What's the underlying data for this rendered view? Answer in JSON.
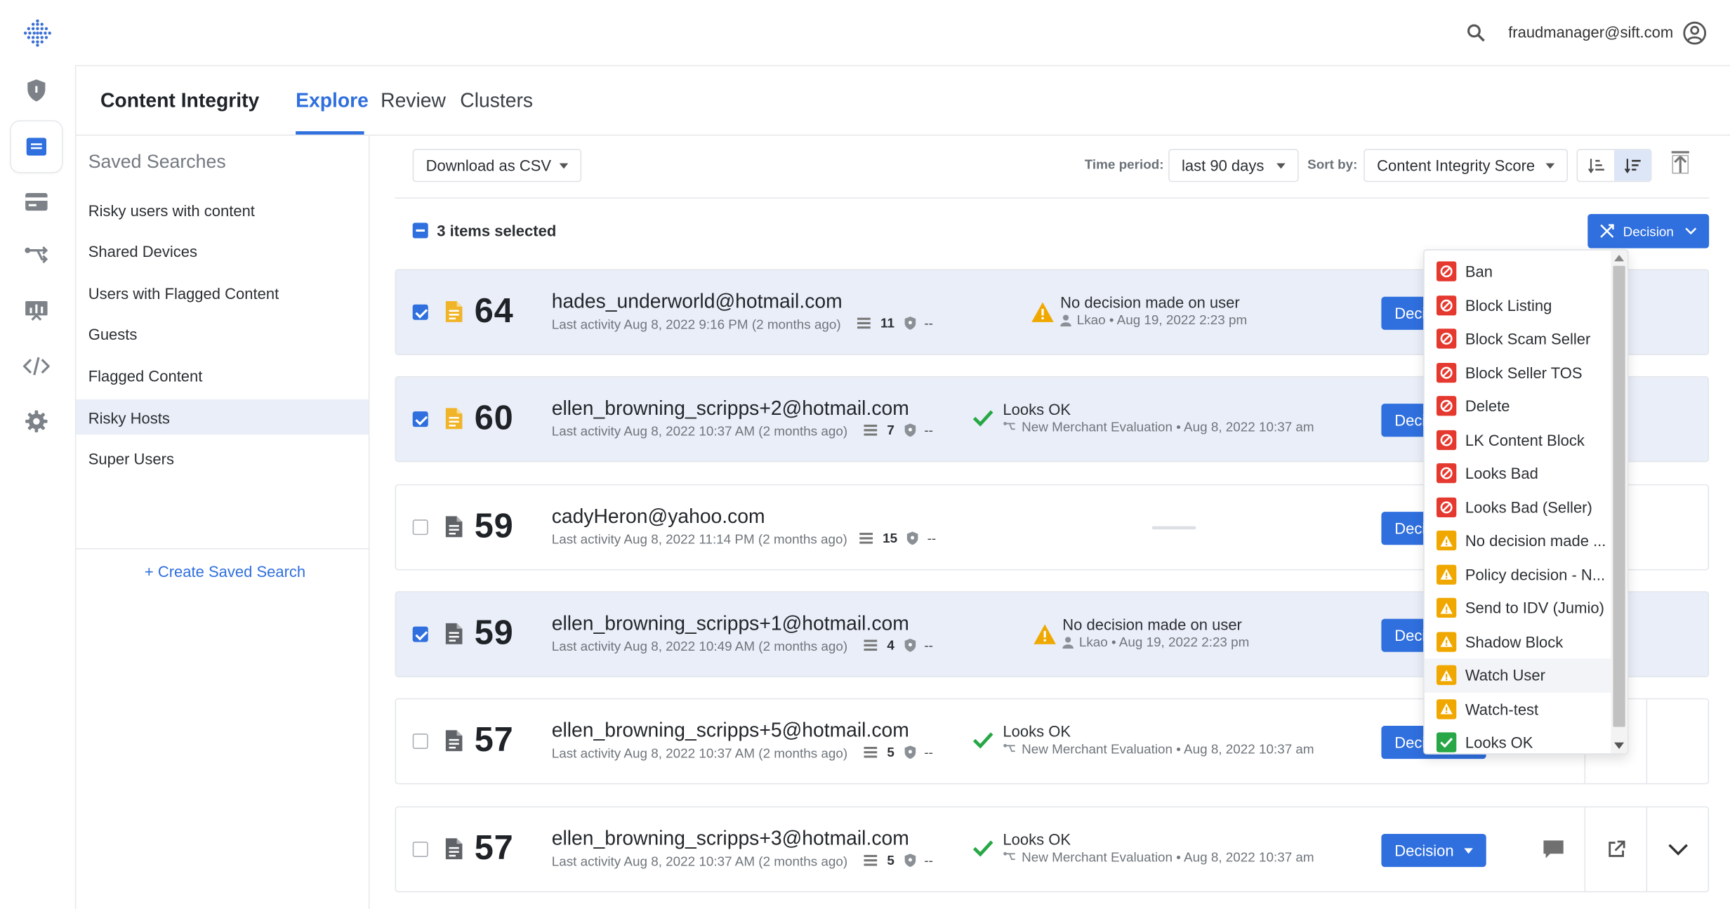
{
  "user": {
    "email": "fraudmanager@sift.com"
  },
  "app": {
    "title": "Content Integrity"
  },
  "tabs": [
    {
      "label": "Explore",
      "active": true
    },
    {
      "label": "Review",
      "active": false
    },
    {
      "label": "Clusters",
      "active": false
    }
  ],
  "saved_searches": {
    "title": "Saved Searches",
    "items": [
      "Risky users with content",
      "Shared Devices",
      "Users with Flagged Content",
      "Guests",
      "Flagged Content",
      "Risky Hosts",
      "Super Users"
    ],
    "active": "Risky Hosts",
    "create_label": "+ Create Saved Search"
  },
  "toolbar": {
    "download_label": "Download as CSV",
    "time_period_label": "Time period:",
    "time_period_value": "last 90 days",
    "sort_by_label": "Sort by:",
    "sort_by_value": "Content Integrity Score"
  },
  "selection": {
    "text": "3 items selected",
    "bulk_label": "Decision"
  },
  "rows": [
    {
      "selected": true,
      "doc_color": "#f0b429",
      "score": "64",
      "email": "hades_underworld@hotmail.com",
      "activity": "Last activity Aug 8, 2022 9:16 PM (2 months ago)",
      "count": "11",
      "shield": "--",
      "status": "No decision made on user",
      "status_type": "warn",
      "status_sub_icon": "user",
      "status_sub": "Lkao • Aug 19, 2022 2:23 pm",
      "decision_label": "Decision"
    },
    {
      "selected": true,
      "doc_color": "#f0b429",
      "score": "60",
      "email": "ellen_browning_scripps+2@hotmail.com",
      "activity": "Last activity Aug 8, 2022 10:37 AM (2 months ago)",
      "count": "7",
      "shield": "--",
      "status": "Looks OK",
      "status_type": "ok",
      "status_sub_icon": "flow",
      "status_sub": "New Merchant Evaluation • Aug 8, 2022 10:37 am",
      "decision_label": "Decision"
    },
    {
      "selected": false,
      "doc_color": "#5f6368",
      "score": "59",
      "email": "cadyHeron@yahoo.com",
      "activity": "Last activity Aug 8, 2022 11:14 PM (2 months ago)",
      "count": "15",
      "shield": "--",
      "status": "",
      "status_type": "none",
      "status_sub_icon": "",
      "status_sub": "",
      "decision_label": "Decision"
    },
    {
      "selected": true,
      "doc_color": "#5f6368",
      "score": "59",
      "email": "ellen_browning_scripps+1@hotmail.com",
      "activity": "Last activity Aug 8, 2022 10:49 AM (2 months ago)",
      "count": "4",
      "shield": "--",
      "status": "No decision made on user",
      "status_type": "warn",
      "status_sub_icon": "user",
      "status_sub": "Lkao • Aug 19, 2022 2:23 pm",
      "decision_label": "Decision"
    },
    {
      "selected": false,
      "doc_color": "#5f6368",
      "score": "57",
      "email": "ellen_browning_scripps+5@hotmail.com",
      "activity": "Last activity Aug 8, 2022 10:37 AM (2 months ago)",
      "count": "5",
      "shield": "--",
      "status": "Looks OK",
      "status_type": "ok",
      "status_sub_icon": "flow",
      "status_sub": "New Merchant Evaluation • Aug 8, 2022 10:37 am",
      "decision_label": "Decision"
    },
    {
      "selected": false,
      "doc_color": "#5f6368",
      "score": "57",
      "email": "ellen_browning_scripps+3@hotmail.com",
      "activity": "Last activity Aug 8, 2022 10:37 AM (2 months ago)",
      "count": "5",
      "shield": "--",
      "status": "Looks OK",
      "status_type": "ok",
      "status_sub_icon": "flow",
      "status_sub": "New Merchant Evaluation • Aug 8, 2022 10:37 am",
      "decision_label": "Decision"
    }
  ],
  "decision_menu": [
    {
      "label": "Ban",
      "type": "block"
    },
    {
      "label": "Block Listing",
      "type": "block"
    },
    {
      "label": "Block Scam Seller",
      "type": "block"
    },
    {
      "label": "Block Seller TOS",
      "type": "block"
    },
    {
      "label": "Delete",
      "type": "block"
    },
    {
      "label": "LK Content Block",
      "type": "block"
    },
    {
      "label": "Looks Bad",
      "type": "block"
    },
    {
      "label": "Looks Bad (Seller)",
      "type": "block"
    },
    {
      "label": "No decision made ...",
      "type": "warn"
    },
    {
      "label": "Policy decision - N...",
      "type": "warn"
    },
    {
      "label": "Send to IDV (Jumio)",
      "type": "warn"
    },
    {
      "label": "Shadow Block",
      "type": "warn"
    },
    {
      "label": "Watch User",
      "type": "warn",
      "hover": true
    },
    {
      "label": "Watch-test",
      "type": "warn"
    },
    {
      "label": "Looks OK",
      "type": "ok"
    }
  ],
  "colors": {
    "accent": "#2f6fde",
    "block": "#e5392f",
    "warn": "#f0a800",
    "ok": "#27a745",
    "selected_row": "#e9eef8"
  },
  "icons": [
    "sift-logo-icon",
    "shield-icon",
    "content-icon",
    "card-icon",
    "workflow-icon",
    "presentation-icon",
    "code-icon",
    "gear-icon",
    "search-icon",
    "user-circle-icon",
    "sort-ascending-icon",
    "sort-descending-icon",
    "collapse-top-icon",
    "document-icon",
    "stack-icon",
    "shield-small-icon",
    "warning-icon",
    "check-icon",
    "comment-icon",
    "external-link-icon",
    "chevron-down-icon"
  ]
}
